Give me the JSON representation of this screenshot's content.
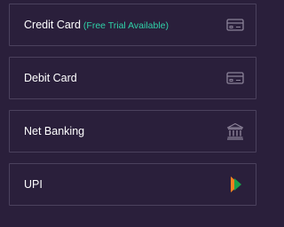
{
  "payment_options": [
    {
      "label": "Credit Card",
      "note": "(Free Trial Available)",
      "icon": "credit-card-icon"
    },
    {
      "label": "Debit Card",
      "icon": "debit-card-icon"
    },
    {
      "label": "Net Banking",
      "icon": "bank-icon"
    },
    {
      "label": "UPI",
      "icon": "upi-logo-icon"
    }
  ],
  "colors": {
    "background": "#2a1f3b",
    "border": "#4b415d",
    "text": "#ffffff",
    "trial_text": "#2fd2a8",
    "icon_stroke": "#8b8298"
  }
}
